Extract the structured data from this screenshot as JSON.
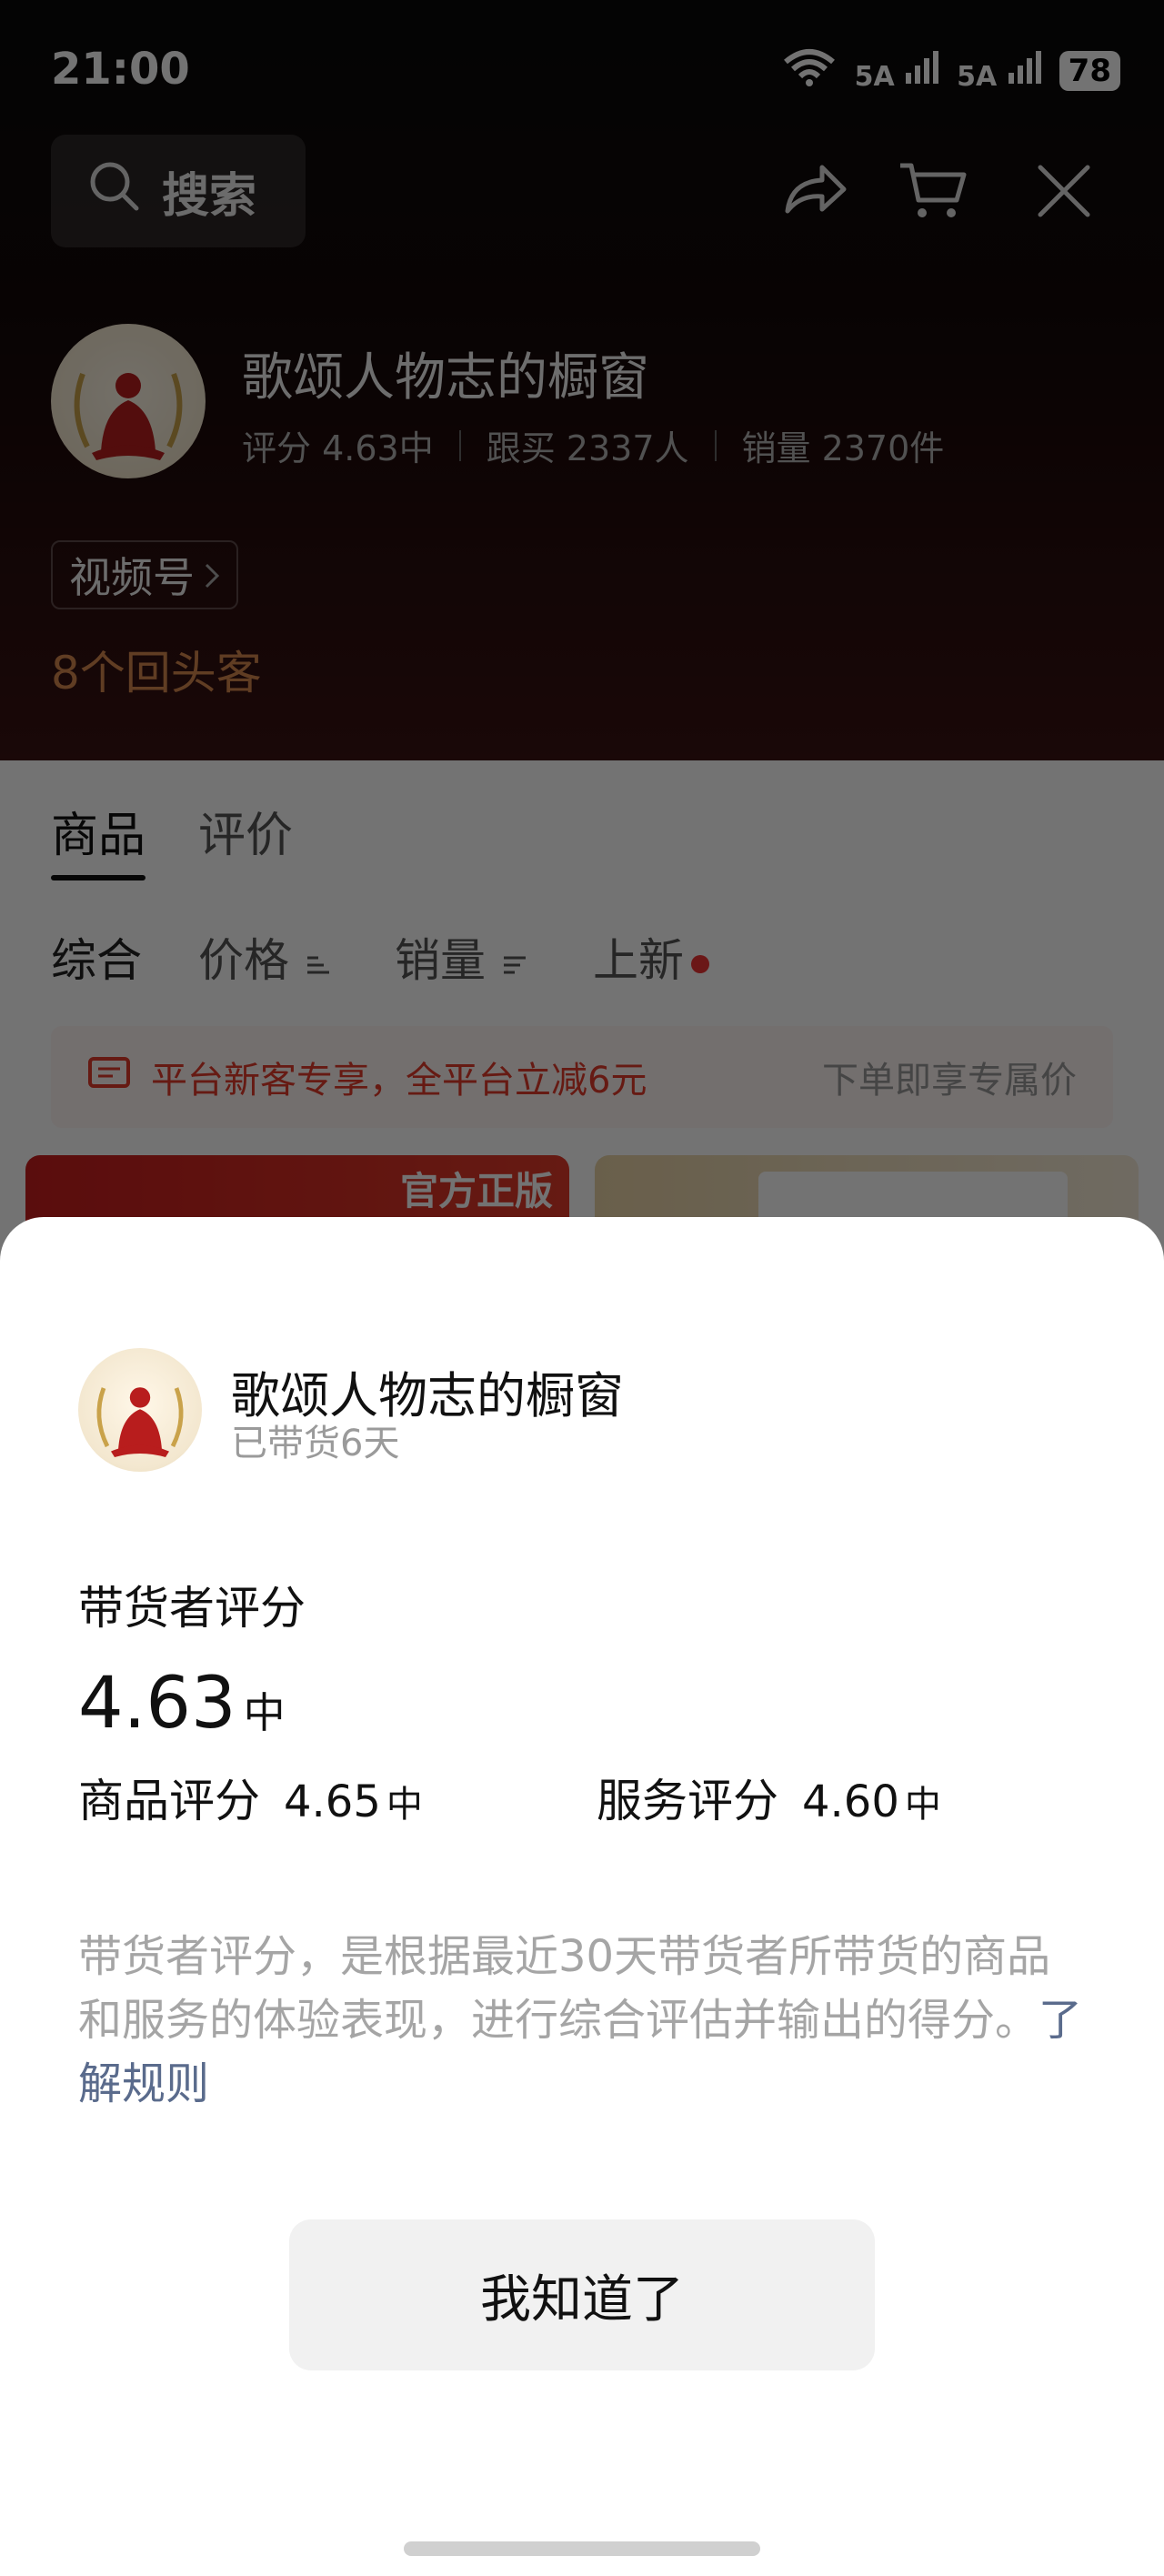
{
  "status_bar": {
    "time": "21:00",
    "wifi": "6",
    "sim1": "5A",
    "sim2": "5A",
    "battery": "78"
  },
  "top_bar": {
    "search_label": "搜索"
  },
  "store": {
    "name": "歌颂人物志的橱窗",
    "rating": "评分 4.63中",
    "followers": "跟买 2337人",
    "sales": "销量 2370件",
    "channel": "视频号",
    "repeat_customers": "8个回头客"
  },
  "tabs": [
    {
      "label": "商品"
    },
    {
      "label": "评价"
    }
  ],
  "filters": [
    {
      "label": "综合"
    },
    {
      "label": "价格"
    },
    {
      "label": "销量"
    },
    {
      "label": "上新"
    }
  ],
  "promo": {
    "left": "平台新客专享，全平台立减6元",
    "right": "下单即享专属价"
  },
  "product_cards": [
    {
      "badge": "官方正版"
    }
  ],
  "sheet": {
    "store_name": "歌颂人物志的橱窗",
    "days": "已带货6天",
    "section_title": "带货者评分",
    "score": "4.63",
    "score_level": "中",
    "product_label": "商品评分",
    "product_score": "4.65",
    "product_level": "中",
    "service_label": "服务评分",
    "service_score": "4.60",
    "service_level": "中",
    "description": "带货者评分，是根据最近30天带货者所带货的商品和服务的体验表现，进行综合评估并输出的得分。",
    "rules_link": "了解规则",
    "confirm_button": "我知道了"
  },
  "colors": {
    "accent_red": "#e23b2a",
    "repeat_orange": "#d6874f",
    "link_blue": "#5a6b8c"
  }
}
